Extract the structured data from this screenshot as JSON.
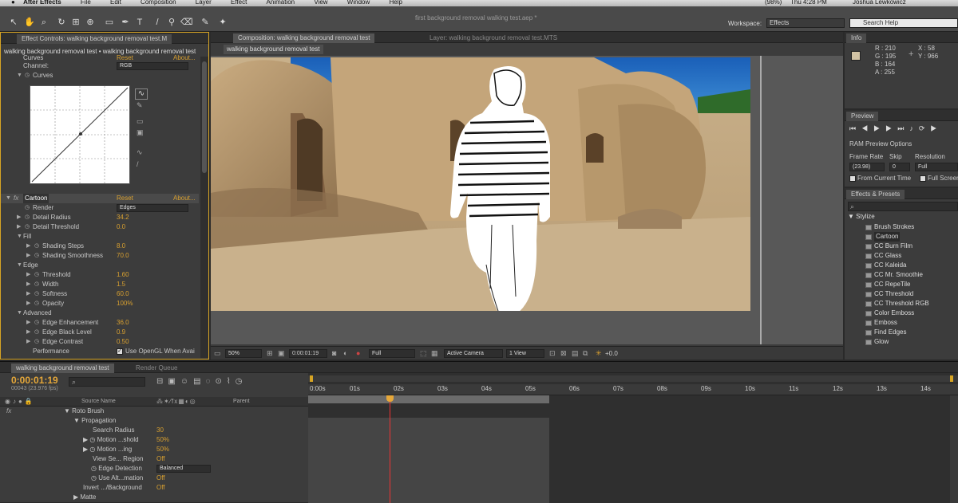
{
  "menubar": {
    "items": [
      "After Effects",
      "File",
      "Edit",
      "Composition",
      "Layer",
      "Effect",
      "Animation",
      "View",
      "Window",
      "Help"
    ],
    "battery": "(98%)",
    "clock": "Thu 4:28 PM",
    "user": "Joshua Lewkowicz"
  },
  "toolbar": {
    "document_title": "first background removal walking test.aep *",
    "workspace_label": "Workspace:",
    "workspace_value": "Effects",
    "search_placeholder": "Search Help"
  },
  "effect_controls": {
    "tab_label": "Effect Controls: walking background removal test.M",
    "subtitle": "walking background removal test • walking background removal test",
    "curves": {
      "cut_label": "Curves",
      "reset_label": "Reset",
      "about_label": "About...",
      "channel_label": "Channel:",
      "channel_value": "RGB",
      "curves_label": "Curves"
    },
    "cartoon": {
      "fx_label": "fx",
      "name": "Cartoon",
      "reset_label": "Reset",
      "about_label": "About...",
      "render_label": "Render",
      "render_value": "Edges",
      "detail_radius_label": "Detail Radius",
      "detail_radius_value": "34.2",
      "detail_threshold_label": "Detail Threshold",
      "detail_threshold_value": "0.0",
      "fill_label": "Fill",
      "shading_steps_label": "Shading Steps",
      "shading_steps_value": "8.0",
      "shading_smoothness_label": "Shading Smoothness",
      "shading_smoothness_value": "70.0",
      "edge_label": "Edge",
      "threshold_label": "Threshold",
      "threshold_value": "1.60",
      "width_label": "Width",
      "width_value": "1.5",
      "softness_label": "Softness",
      "softness_value": "60.0",
      "opacity_label": "Opacity",
      "opacity_value": "100%",
      "advanced_label": "Advanced",
      "edge_enhancement_label": "Edge Enhancement",
      "edge_enhancement_value": "36.0",
      "edge_black_level_label": "Edge Black Level",
      "edge_black_level_value": "0.9",
      "edge_contrast_label": "Edge Contrast",
      "edge_contrast_value": "0.50",
      "performance_label": "Performance",
      "opengl_label": "Use OpenGL When Avai"
    }
  },
  "composition": {
    "tab_label": "Composition: walking background removal test",
    "layer_tab_label": "Layer: walking background removal test.MTS",
    "breadcrumb": "walking background removal test",
    "footer": {
      "zoom": "50%",
      "timecode": "0:00:01:19",
      "resolution": "Full",
      "camera": "Active Camera",
      "views": "1 View",
      "exposure": "+0.0"
    }
  },
  "info": {
    "title": "Info",
    "r": "R : 210",
    "g": "G : 195",
    "b": "B : 164",
    "a": "A : 255",
    "x": "X : 58",
    "y": "Y : 966",
    "swatch_color": "#d2c3a4"
  },
  "preview": {
    "title": "Preview",
    "ram_options": "RAM Preview Options",
    "frame_rate_label": "Frame Rate",
    "skip_label": "Skip",
    "resolution_label": "Resolution",
    "frame_rate_value": "(23.98)",
    "skip_value": "0",
    "resolution_value": "Full",
    "from_current": "From Current Time",
    "full_screen": "Full Screen"
  },
  "effects_presets": {
    "title": "Effects & Presets",
    "category": "Stylize",
    "items": [
      "Brush Strokes",
      "Cartoon",
      "CC Burn Film",
      "CC Glass",
      "CC Kaleida",
      "CC Mr. Smoothie",
      "CC RepeTile",
      "CC Threshold",
      "CC Threshold RGB",
      "Color Emboss",
      "Emboss",
      "Find Edges",
      "Glow"
    ],
    "selected": "Cartoon"
  },
  "timeline": {
    "tab_label": "walking background removal test",
    "render_queue_label": "Render Queue",
    "timecode": "0:00:01:19",
    "frame_info": "00043 (23.976 fps)",
    "source_name_header": "Source Name",
    "parent_header": "Parent",
    "ruler_labels": [
      "0:00s",
      "01s",
      "02s",
      "03s",
      "04s",
      "05s",
      "06s",
      "07s",
      "08s",
      "09s",
      "10s",
      "11s",
      "12s",
      "13s",
      "14s"
    ],
    "rows": [
      {
        "label": "fx",
        "value": ""
      },
      {
        "label": "Roto Brush",
        "value": ""
      },
      {
        "label": "Propagation",
        "value": ""
      },
      {
        "label": "Search Radius",
        "value": "30"
      },
      {
        "label": "Motion ...shold",
        "value": "50%"
      },
      {
        "label": "Motion ...ing",
        "value": "50%"
      },
      {
        "label": "View Se... Region",
        "value": "Off"
      },
      {
        "label": "Edge Detection",
        "value": "Balanced"
      },
      {
        "label": "Use Alt...mation",
        "value": "Off"
      },
      {
        "label": "Invert .../Background",
        "value": "Off"
      },
      {
        "label": "Matte",
        "value": ""
      }
    ]
  }
}
